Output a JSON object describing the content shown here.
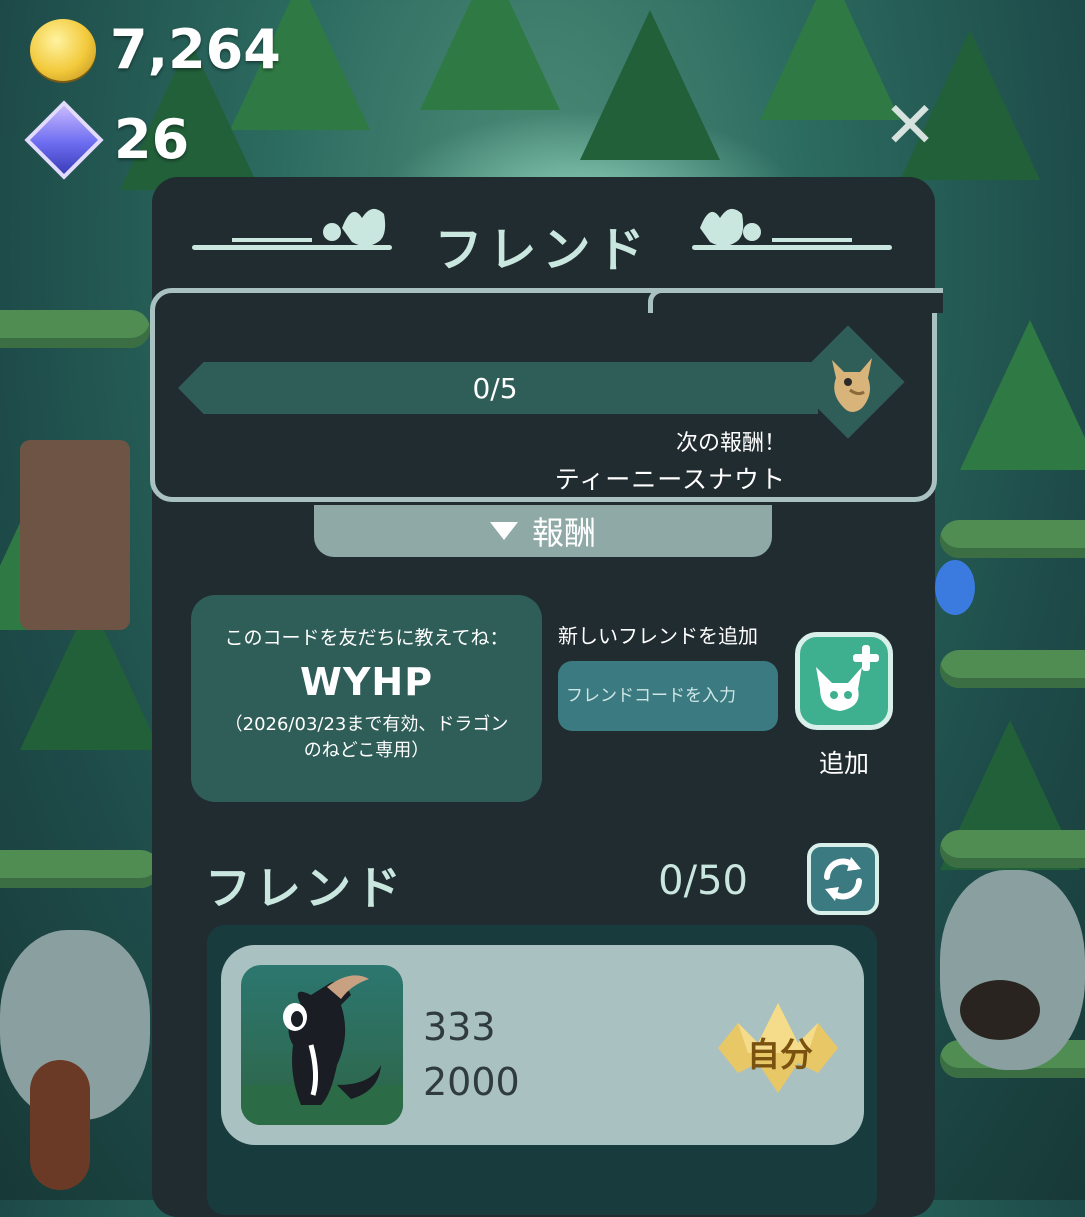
{
  "hud": {
    "coins": "7,264",
    "gems": "26"
  },
  "panel": {
    "title": "フレンド",
    "progress": {
      "text": "0/5",
      "current": 0,
      "total": 5
    },
    "next_reward_label": "次の報酬！",
    "next_reward_name": "ティーニースナウト",
    "reward_tab_label": "報酬"
  },
  "share_code": {
    "label": "このコードを友だちに教えてね：",
    "code": "WYHP",
    "note": "（2026/03/23まで有効、ドラゴンのねどこ専用）"
  },
  "add_friend": {
    "label": "新しいフレンドを追加",
    "placeholder": "フレンドコードを入力",
    "button_label": "追加"
  },
  "friends": {
    "title": "フレンド",
    "count": "0/50",
    "list": [
      {
        "name": "333",
        "score": "2000",
        "badge": "自分"
      }
    ]
  },
  "icons": {
    "coin": "coin-icon",
    "gem": "gem-icon",
    "close": "close-icon",
    "add": "add-friend-icon",
    "refresh": "refresh-icon"
  },
  "colors": {
    "panel_bg": "#212c30",
    "accent_teal": "#2f5d58",
    "button_green": "#3eb08f",
    "text_mint": "#c9e6df",
    "badge_gold": "#e8c766"
  }
}
